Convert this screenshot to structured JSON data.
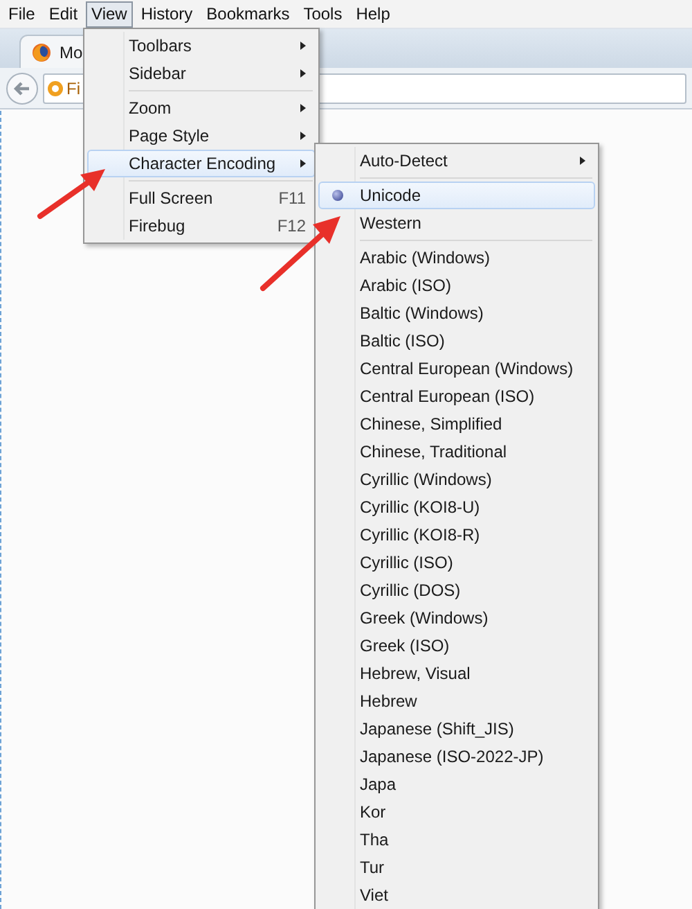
{
  "menubar": [
    {
      "label": "File",
      "selected": false
    },
    {
      "label": "Edit",
      "selected": false
    },
    {
      "label": "View",
      "selected": true
    },
    {
      "label": "History",
      "selected": false
    },
    {
      "label": "Bookmarks",
      "selected": false
    },
    {
      "label": "Tools",
      "selected": false
    },
    {
      "label": "Help",
      "selected": false
    }
  ],
  "browser": {
    "tab_title": "Mo",
    "url": "Fi"
  },
  "view_menu": [
    {
      "kind": "item",
      "label": "Toolbars",
      "submenu": true,
      "selected": false
    },
    {
      "kind": "item",
      "label": "Sidebar",
      "submenu": true,
      "selected": false
    },
    {
      "kind": "separator"
    },
    {
      "kind": "item",
      "label": "Zoom",
      "submenu": true,
      "selected": false
    },
    {
      "kind": "item",
      "label": "Page Style",
      "submenu": true,
      "selected": false
    },
    {
      "kind": "item",
      "label": "Character Encoding",
      "submenu": true,
      "selected": true
    },
    {
      "kind": "separator"
    },
    {
      "kind": "item",
      "label": "Full Screen",
      "shortcut": "F11",
      "submenu": false,
      "selected": false
    },
    {
      "kind": "item",
      "label": "Firebug",
      "shortcut": "F12",
      "submenu": false,
      "selected": false
    }
  ],
  "encoding_menu": [
    {
      "kind": "item",
      "label": "Auto-Detect",
      "submenu": true,
      "checked": false,
      "selected": false
    },
    {
      "kind": "separator"
    },
    {
      "kind": "item",
      "label": "Unicode",
      "submenu": false,
      "checked": true,
      "selected": true
    },
    {
      "kind": "item",
      "label": "Western",
      "submenu": false,
      "checked": false,
      "selected": false
    },
    {
      "kind": "separator"
    },
    {
      "kind": "item",
      "label": "Arabic (Windows)",
      "submenu": false,
      "checked": false,
      "selected": false
    },
    {
      "kind": "item",
      "label": "Arabic (ISO)",
      "submenu": false,
      "checked": false,
      "selected": false
    },
    {
      "kind": "item",
      "label": "Baltic (Windows)",
      "submenu": false,
      "checked": false,
      "selected": false
    },
    {
      "kind": "item",
      "label": "Baltic (ISO)",
      "submenu": false,
      "checked": false,
      "selected": false
    },
    {
      "kind": "item",
      "label": "Central European (Windows)",
      "submenu": false,
      "checked": false,
      "selected": false
    },
    {
      "kind": "item",
      "label": "Central European (ISO)",
      "submenu": false,
      "checked": false,
      "selected": false
    },
    {
      "kind": "item",
      "label": "Chinese, Simplified",
      "submenu": false,
      "checked": false,
      "selected": false
    },
    {
      "kind": "item",
      "label": "Chinese, Traditional",
      "submenu": false,
      "checked": false,
      "selected": false
    },
    {
      "kind": "item",
      "label": "Cyrillic (Windows)",
      "submenu": false,
      "checked": false,
      "selected": false
    },
    {
      "kind": "item",
      "label": "Cyrillic (KOI8-U)",
      "submenu": false,
      "checked": false,
      "selected": false
    },
    {
      "kind": "item",
      "label": "Cyrillic (KOI8-R)",
      "submenu": false,
      "checked": false,
      "selected": false
    },
    {
      "kind": "item",
      "label": "Cyrillic (ISO)",
      "submenu": false,
      "checked": false,
      "selected": false
    },
    {
      "kind": "item",
      "label": "Cyrillic (DOS)",
      "submenu": false,
      "checked": false,
      "selected": false
    },
    {
      "kind": "item",
      "label": "Greek (Windows)",
      "submenu": false,
      "checked": false,
      "selected": false
    },
    {
      "kind": "item",
      "label": "Greek (ISO)",
      "submenu": false,
      "checked": false,
      "selected": false
    },
    {
      "kind": "item",
      "label": "Hebrew, Visual",
      "submenu": false,
      "checked": false,
      "selected": false
    },
    {
      "kind": "item",
      "label": "Hebrew",
      "submenu": false,
      "checked": false,
      "selected": false
    },
    {
      "kind": "item",
      "label": "Japanese (Shift_JIS)",
      "submenu": false,
      "checked": false,
      "selected": false
    },
    {
      "kind": "item",
      "label": "Japanese (ISO-2022-JP)",
      "submenu": false,
      "checked": false,
      "selected": false
    },
    {
      "kind": "item",
      "label": "Japa",
      "submenu": false,
      "checked": false,
      "selected": false
    },
    {
      "kind": "item",
      "label": "Kor",
      "submenu": false,
      "checked": false,
      "selected": false
    },
    {
      "kind": "item",
      "label": "Tha",
      "submenu": false,
      "checked": false,
      "selected": false
    },
    {
      "kind": "item",
      "label": "Tur",
      "submenu": false,
      "checked": false,
      "selected": false
    },
    {
      "kind": "item",
      "label": "Viet",
      "submenu": false,
      "checked": false,
      "selected": false
    }
  ]
}
